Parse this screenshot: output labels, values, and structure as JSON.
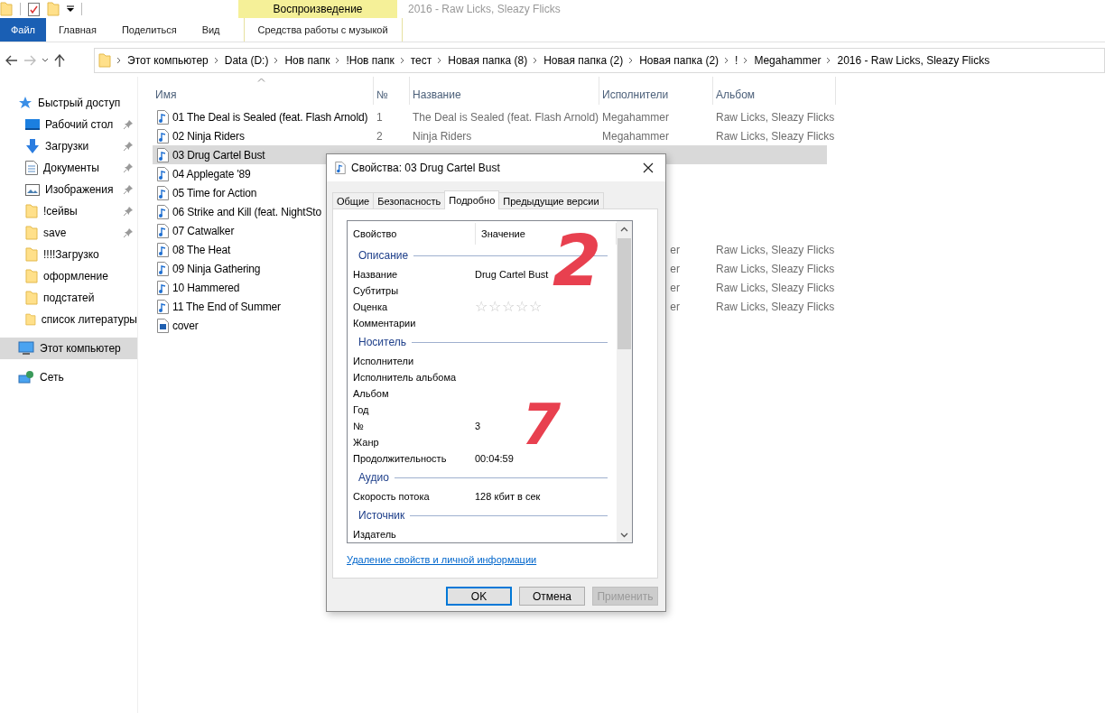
{
  "window": {
    "title": "2016 - Raw Licks, Sleazy Flicks"
  },
  "ribbon": {
    "context_group": "Воспроизведение",
    "tabs": [
      {
        "label": "Файл",
        "kind": "file"
      },
      {
        "label": "Главная",
        "kind": "normal"
      },
      {
        "label": "Поделиться",
        "kind": "normal"
      },
      {
        "label": "Вид",
        "kind": "normal"
      },
      {
        "label": "Средства работы с музыкой",
        "kind": "context"
      }
    ]
  },
  "address_bar": {
    "path": [
      "Этот компьютер",
      "Data (D:)",
      "Нов папк",
      "!Нов папк",
      "тест",
      "Новая папка (8)",
      "Новая папка (2)",
      "Новая папка (2)",
      "!",
      "Megahammer",
      "2016 - Raw Licks, Sleazy Flicks"
    ]
  },
  "nav_pane": {
    "items": [
      {
        "label": "Быстрый доступ",
        "kind": "quick",
        "pinned": false,
        "selected": false
      },
      {
        "label": "Рабочий стол",
        "kind": "desktop",
        "pinned": true,
        "selected": false
      },
      {
        "label": "Загрузки",
        "kind": "downloads",
        "pinned": true,
        "selected": false
      },
      {
        "label": "Документы",
        "kind": "documents",
        "pinned": true,
        "selected": false
      },
      {
        "label": "Изображения",
        "kind": "pictures",
        "pinned": true,
        "selected": false
      },
      {
        "label": "!сейвы",
        "kind": "folder",
        "pinned": true,
        "selected": false
      },
      {
        "label": "save",
        "kind": "folder",
        "pinned": true,
        "selected": false
      },
      {
        "label": "!!!!Загрузко",
        "kind": "folder",
        "pinned": false,
        "selected": false
      },
      {
        "label": "оформление",
        "kind": "folder",
        "pinned": false,
        "selected": false
      },
      {
        "label": "подстатей",
        "kind": "folder",
        "pinned": false,
        "selected": false
      },
      {
        "label": "список литературы",
        "kind": "folder",
        "pinned": false,
        "selected": false
      },
      {
        "label": "Этот компьютер",
        "kind": "computer",
        "pinned": false,
        "selected": true
      },
      {
        "label": "Сеть",
        "kind": "network",
        "pinned": false,
        "selected": false
      }
    ]
  },
  "file_list": {
    "columns": [
      {
        "label": "Имя",
        "sorted": true
      },
      {
        "label": "№",
        "sorted": false
      },
      {
        "label": "Название",
        "sorted": false
      },
      {
        "label": "Исполнители",
        "sorted": false
      },
      {
        "label": "Альбом",
        "sorted": false
      }
    ],
    "rows": [
      {
        "name": "01 The Deal is Sealed (feat. Flash Arnold)",
        "kind": "audio",
        "selected": false,
        "number": "1",
        "title": "The Deal is Sealed (feat. Flash Arnold)",
        "artist": "Megahammer",
        "album": "Raw Licks, Sleazy Flicks"
      },
      {
        "name": "02 Ninja Riders",
        "kind": "audio",
        "selected": false,
        "number": "2",
        "title": "Ninja Riders",
        "artist": "Megahammer",
        "album": "Raw Licks, Sleazy Flicks"
      },
      {
        "name": "03 Drug Cartel Bust",
        "kind": "audio",
        "selected": true
      },
      {
        "name": "04 Applegate '89",
        "kind": "audio",
        "selected": false
      },
      {
        "name": "05 Time for Action",
        "kind": "audio",
        "selected": false
      },
      {
        "name": "06 Strike and Kill (feat. NightSto",
        "kind": "audio",
        "selected": false
      },
      {
        "name": "07 Catwalker",
        "kind": "audio",
        "selected": false
      },
      {
        "name": "08 The Heat",
        "kind": "audio",
        "selected": false,
        "artist": "er",
        "partly_hidden": true,
        "album": "Raw Licks, Sleazy Flicks"
      },
      {
        "name": "09 Ninja Gathering",
        "kind": "audio",
        "selected": false,
        "artist": "er",
        "partly_hidden": true,
        "album": "Raw Licks, Sleazy Flicks"
      },
      {
        "name": "10 Hammered",
        "kind": "audio",
        "selected": false,
        "artist": "er",
        "partly_hidden": true,
        "album": "Raw Licks, Sleazy Flicks"
      },
      {
        "name": "11 The End of Summer",
        "kind": "audio",
        "selected": false,
        "artist": "er",
        "partly_hidden": true,
        "album": "Raw Licks, Sleazy Flicks"
      },
      {
        "name": "cover",
        "kind": "image",
        "selected": false
      }
    ]
  },
  "dialog": {
    "title": "Свойства: 03 Drug Cartel Bust",
    "tabs": [
      {
        "label": "Общие",
        "selected": false
      },
      {
        "label": "Безопасность",
        "selected": false
      },
      {
        "label": "Подробно",
        "selected": true
      },
      {
        "label": "Предыдущие версии",
        "selected": false
      }
    ],
    "columns": [
      "Свойство",
      "Значение"
    ],
    "sections": [
      {
        "heading": "Описание",
        "rows": [
          {
            "property": "Название",
            "value": "Drug Cartel Bust"
          },
          {
            "property": "Субтитры"
          },
          {
            "property": "Оценка",
            "kind": "rating",
            "stars": 0
          },
          {
            "property": "Комментарии"
          }
        ]
      },
      {
        "heading": "Носитель",
        "rows": [
          {
            "property": "Исполнители"
          },
          {
            "property": "Исполнитель альбома"
          },
          {
            "property": "Альбом"
          },
          {
            "property": "Год"
          },
          {
            "property": "№",
            "value": "3"
          },
          {
            "property": "Жанр"
          },
          {
            "property": "Продолжительность",
            "value": "00:04:59"
          }
        ]
      },
      {
        "heading": "Аудио",
        "rows": [
          {
            "property": "Скорость потока",
            "value": "128 кбит в сек"
          }
        ]
      },
      {
        "heading": "Источник",
        "rows": [
          {
            "property": "Издатель"
          }
        ]
      }
    ],
    "link": "Удаление свойств и личной информации",
    "buttons": [
      {
        "label": "OK",
        "default": true,
        "disabled": false
      },
      {
        "label": "Отмена",
        "default": false,
        "disabled": false
      },
      {
        "label": "Применить",
        "default": false,
        "disabled": true
      }
    ]
  },
  "annotations": [
    {
      "text": "2",
      "color": "#e8404f"
    },
    {
      "text": "7",
      "color": "#e8404f"
    }
  ]
}
